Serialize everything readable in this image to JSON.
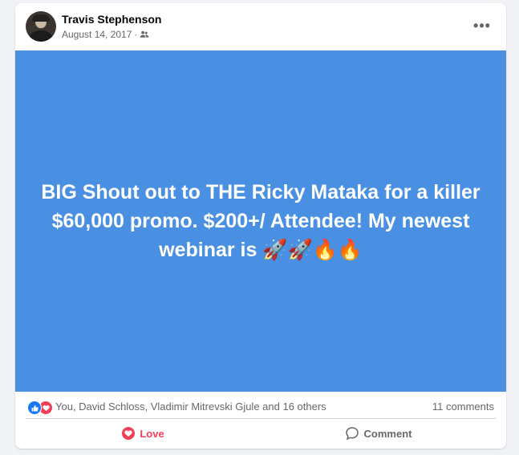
{
  "post": {
    "author": "Travis Stephenson",
    "date": "August 14, 2017",
    "separator": "·",
    "audience_icon": "friends-icon",
    "more_label": "•••",
    "image_text": "BIG Shout out to THE Ricky Mataka for a killer $60,000 promo. $200+/ Attendee! My newest webinar is 🚀🚀🔥🔥",
    "image_background": "#4a90e2"
  },
  "reactions": {
    "icons": [
      "like-icon",
      "love-icon"
    ],
    "names": "You, David Schloss, Vladimir Mitrevski Gjule and 16 others",
    "comments": "11 comments"
  },
  "actions": {
    "love_label": "Love",
    "comment_label": "Comment"
  },
  "colors": {
    "like": "#1877f2",
    "love": "#f33e58",
    "secondary_text": "#65676b"
  }
}
